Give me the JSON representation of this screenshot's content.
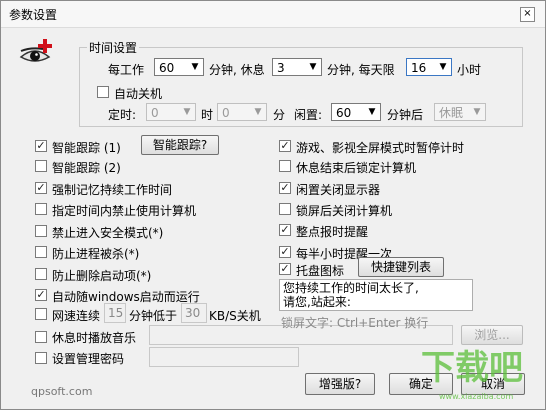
{
  "window": {
    "title": "参数设置",
    "close": "×"
  },
  "time_group": {
    "label": "时间设置",
    "work_prefix": "每工作",
    "work_value": "60",
    "minutes_rest": "分钟, 休息",
    "rest_value": "3",
    "minutes_daily": "分钟, 每天限",
    "daily_value": "16",
    "hours": "小时",
    "autoshutdown_label": "自动关机",
    "scheduled_label": "定时:",
    "hour_value": "0",
    "hour_unit": "时",
    "minute_value": "0",
    "minute_unit": "分",
    "idle_label": "闲置:",
    "idle_value": "60",
    "after_label": "分钟后",
    "action_value": "休眠"
  },
  "left_options": [
    {
      "label": "智能跟踪 (1)",
      "checked": true
    },
    {
      "label": "智能跟踪 (2)",
      "checked": false
    },
    {
      "label": "强制记忆持续工作时间",
      "checked": true
    },
    {
      "label": "指定时间内禁止使用计算机",
      "checked": false
    },
    {
      "label": "禁止进入安全模式(*)",
      "checked": false
    },
    {
      "label": "防止进程被杀(*)",
      "checked": false
    },
    {
      "label": "防止删除启动项(*)",
      "checked": false
    },
    {
      "label": "自动随windows启动而运行",
      "checked": true
    }
  ],
  "smart_track_button": "智能跟踪?",
  "net_speed": {
    "label_prefix": "网速连续",
    "minutes_value": "15",
    "label_mid": "分钟低于",
    "kb_value": "30",
    "label_suffix": "KB/S关机",
    "checked": false
  },
  "rest_music": {
    "label": "休息时播放音乐",
    "checked": false,
    "path": "",
    "browse": "浏览..."
  },
  "admin_pwd": {
    "label": "设置管理密码",
    "checked": false,
    "value": ""
  },
  "right_options": [
    {
      "label": "游戏、影视全屏模式时暂停计时",
      "checked": true
    },
    {
      "label": "休息结束后锁定计算机",
      "checked": false
    },
    {
      "label": "闲置关闭显示器",
      "checked": true
    },
    {
      "label": "锁屏后关闭计算机",
      "checked": false
    },
    {
      "label": "整点报时提醒",
      "checked": true
    },
    {
      "label": "每半小时提醒一次",
      "checked": true
    },
    {
      "label": "托盘图标",
      "checked": true
    }
  ],
  "shortcut_button": "快捷键列表",
  "message_text": "您持续工作的时间太长了,\n请您,站起来:",
  "lock_hint": "锁屏文字: Ctrl+Enter 换行",
  "footer": {
    "site": "qpsoft.com",
    "enhanced": "增强版?",
    "ok": "确定",
    "cancel": "取消"
  },
  "watermark": "下载吧",
  "watermark_url": "www.xiazaiba.com",
  "colors": {
    "watermark": "#5bbf3a",
    "logo_red": "#d0101a"
  }
}
